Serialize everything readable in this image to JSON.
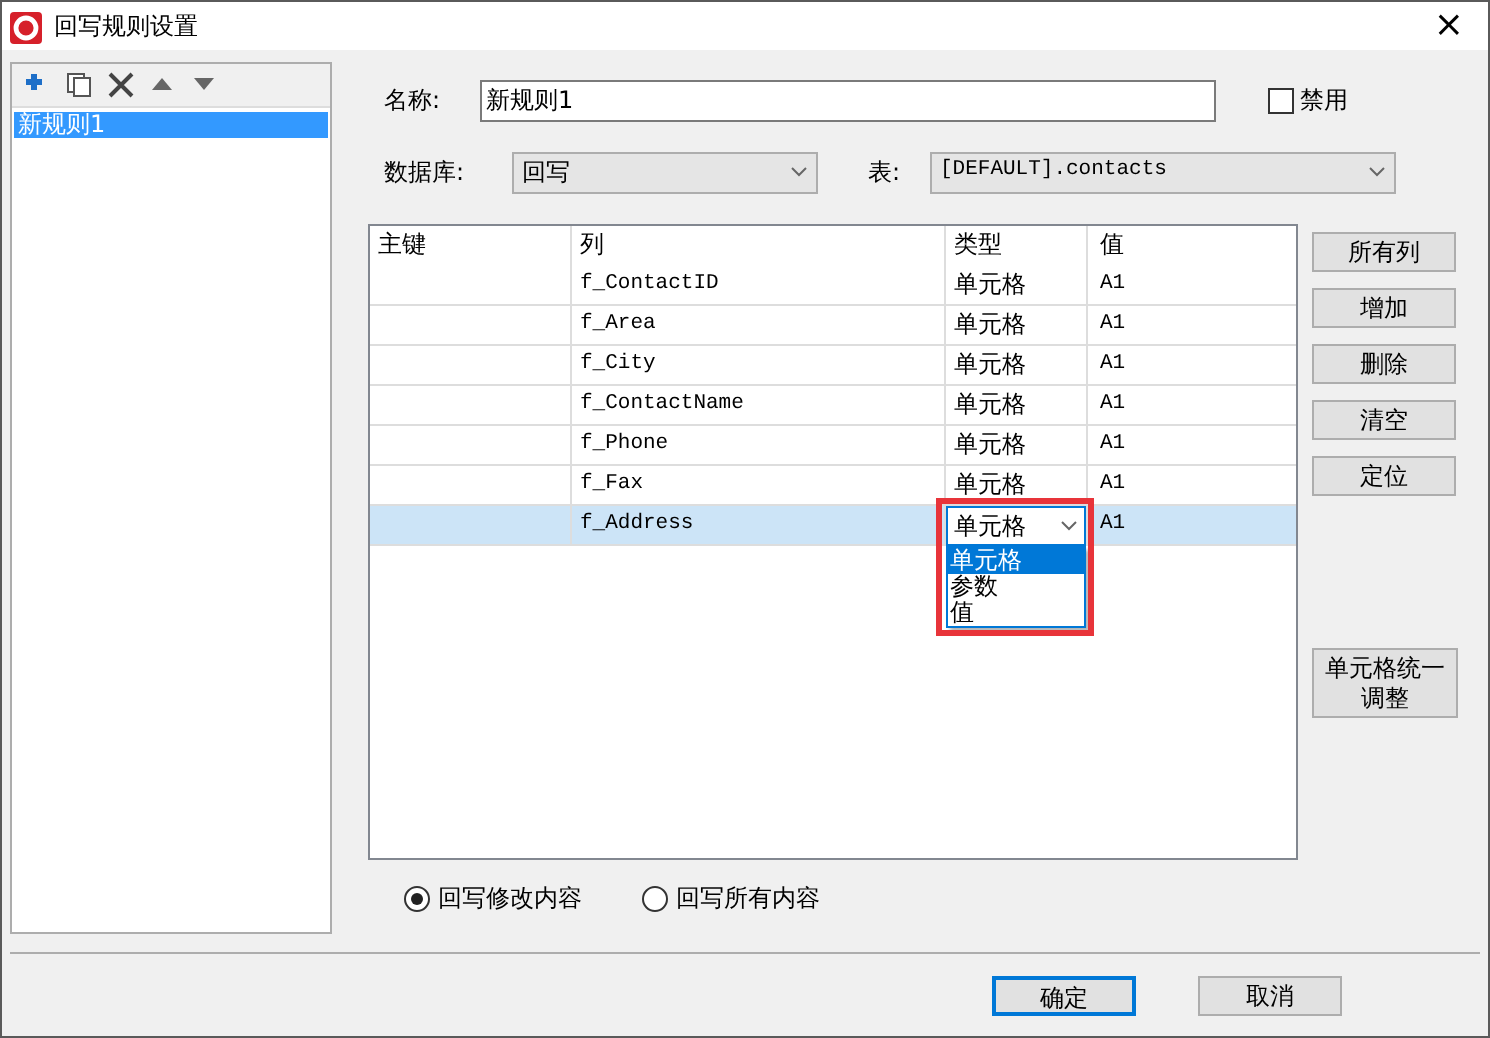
{
  "window": {
    "title": "回写规则设置",
    "close": "×"
  },
  "toolbar": [
    {
      "kind": "add"
    },
    {
      "kind": "copy"
    },
    {
      "kind": "delete"
    },
    {
      "kind": "up"
    },
    {
      "kind": "down"
    }
  ],
  "rules": [
    {
      "label": "新规则1",
      "selected": true
    }
  ],
  "name_label": "名称:",
  "name_value": "新规则1",
  "disable": {
    "label": "禁用",
    "checked": false
  },
  "db_label": "数据库:",
  "db_value": "回写",
  "table_label": "表:",
  "table_value": "[DEFAULT].contacts",
  "grid": {
    "columns": [
      "主键",
      "列",
      "类型",
      "值"
    ],
    "rows": [
      {
        "column": "f_ContactID",
        "type": "单元格",
        "value": "A1",
        "selected": false
      },
      {
        "column": "f_Area",
        "type": "单元格",
        "value": "A1",
        "selected": false
      },
      {
        "column": "f_City",
        "type": "单元格",
        "value": "A1",
        "selected": false
      },
      {
        "column": "f_ContactName",
        "type": "单元格",
        "value": "A1",
        "selected": false
      },
      {
        "column": "f_Phone",
        "type": "单元格",
        "value": "A1",
        "selected": false
      },
      {
        "column": "f_Fax",
        "type": "单元格",
        "value": "A1",
        "selected": false
      },
      {
        "column": "f_Address",
        "type": "单元格",
        "value": "A1",
        "selected": true,
        "editing": true
      }
    ],
    "dropdown_options": [
      {
        "label": "单元格",
        "selected": true
      },
      {
        "label": "参数",
        "selected": false
      },
      {
        "label": "值",
        "selected": false
      }
    ]
  },
  "side_buttons": [
    "所有列",
    "增加",
    "删除",
    "清空",
    "定位"
  ],
  "bulk_button": "单元格统一调整",
  "modes": [
    {
      "label": "回写修改内容",
      "selected": true
    },
    {
      "label": "回写所有内容",
      "selected": false
    }
  ],
  "ok": "确定",
  "cancel": "取消"
}
